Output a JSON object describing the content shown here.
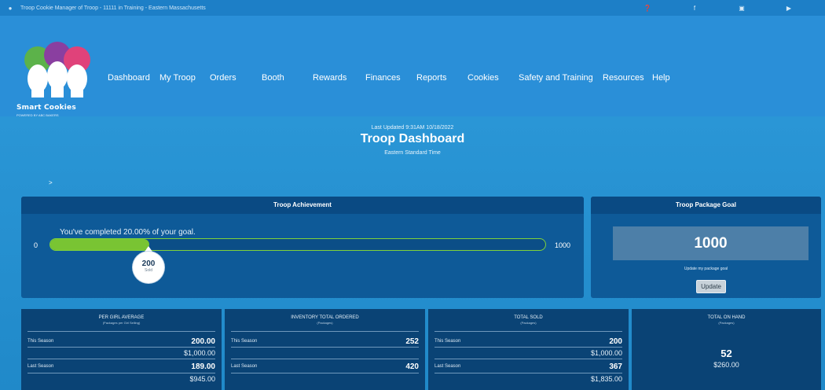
{
  "topbar": {
    "title": "Troop Cookie Manager of Troop - 11111 in Training - Eastern Massachusetts",
    "icons": [
      "user-icon",
      "help-icon",
      "facebook-icon",
      "instagram-icon",
      "youtube-icon"
    ]
  },
  "logo": {
    "name": "Smart Cookies",
    "tagline": "POWERED BY ABC BAKERS"
  },
  "nav": {
    "items": [
      "Dashboard",
      "My Troop",
      "Orders",
      "Booth",
      "Rewards",
      "Finances",
      "Reports",
      "Cookies",
      "Safety and Training",
      "Resources",
      "Help"
    ]
  },
  "dashboard": {
    "last_updated": "Last Updated 9:31AM 10/18/2022",
    "title": "Troop Dashboard",
    "timezone": "Eastern Standard Time",
    "expander": ">"
  },
  "achievement": {
    "header": "Troop Achievement",
    "message": "You've completed 20.00% of your goal.",
    "min_label": "0",
    "max_label": "1000",
    "progress_fraction": 0.2,
    "sold_value": "200",
    "sold_label": "Sold"
  },
  "package_goal": {
    "header": "Troop Package Goal",
    "value": "1000",
    "label": "Update my package goal",
    "button": "Update"
  },
  "stats": {
    "per_girl": {
      "title": "PER GIRL AVERAGE",
      "subtitle": "(Packages per Girl Selling)",
      "this_label": "This Season",
      "this_value": "200.00",
      "this_dollars": "$1,000.00",
      "last_label": "Last Season",
      "last_value": "189.00",
      "last_dollars": "$945.00"
    },
    "inventory": {
      "title": "INVENTORY TOTAL ORDERED",
      "subtitle": "(Packages)",
      "this_label": "This Season",
      "this_value": "252",
      "last_label": "Last Season",
      "last_value": "420"
    },
    "total_sold": {
      "title": "TOTAL SOLD",
      "subtitle": "(Packages)",
      "this_label": "This Season",
      "this_value": "200",
      "this_dollars": "$1,000.00",
      "last_label": "Last Season",
      "last_value": "367",
      "last_dollars": "$1,835.00"
    },
    "on_hand": {
      "title": "TOTAL ON HAND",
      "subtitle": "(Packages)",
      "value": "52",
      "dollars": "$260.00"
    }
  },
  "colors": {
    "header_blue": "#2a8fd8",
    "panel_navy": "#0e5a98",
    "progress_green": "#79c433"
  }
}
